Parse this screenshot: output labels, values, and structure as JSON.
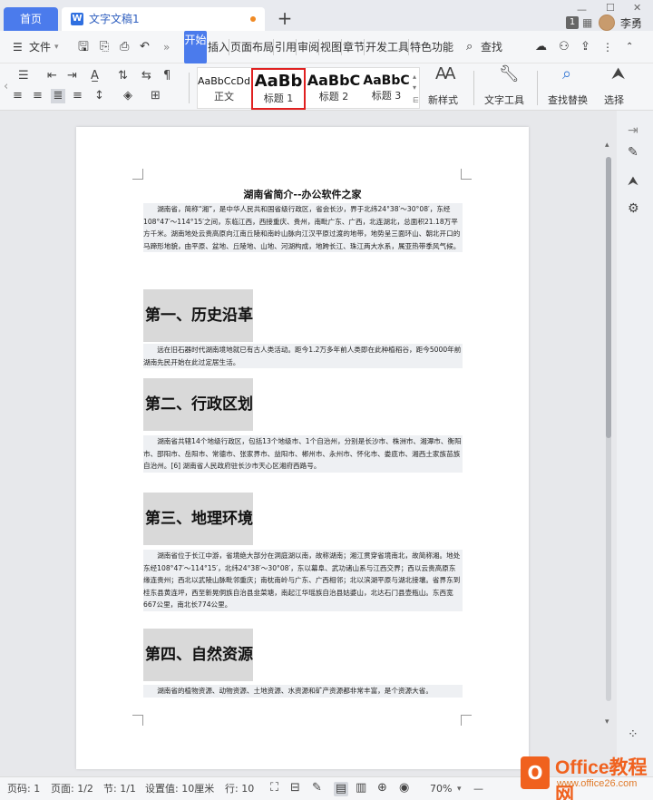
{
  "tabs": {
    "home": "首页",
    "doc_icon": "W",
    "doc_title": "文字文稿1",
    "plus": "+",
    "badge": "1",
    "user_name": "李勇"
  },
  "menu": {
    "file": "文件",
    "items": [
      "开始",
      "插入",
      "页面布局",
      "引用",
      "审阅",
      "视图",
      "章节",
      "开发工具",
      "特色功能"
    ],
    "search": "查找"
  },
  "ribbon": {
    "styles": [
      {
        "sample": "AaBbCcDd",
        "label": "正文"
      },
      {
        "sample": "AaBb",
        "label": "标题 1"
      },
      {
        "sample": "AaBbC",
        "label": "标题 2"
      },
      {
        "sample": "AaBbC",
        "label": "标题 3"
      }
    ],
    "new_style": "新样式",
    "text_tools": "文字工具",
    "find_replace": "查找替换",
    "select": "选择"
  },
  "document": {
    "title": "湖南省简介--办公软件之家",
    "intro": "湖南省，简称“湘”，是中华人民共和国省级行政区，省会长沙，界于北纬24°38′～30°08′，东经108°47′～114°15′之间，东临江西，西接重庆、贵州，南毗广东、广西，北连湖北，总面积21.18万平方千米。湖南地处云贵高原向江南丘陵和南岭山脉向江汉平原过渡的地带，地势呈三面环山、朝北开口的马蹄形地貌，由平原、盆地、丘陵地、山地、河湖构成，地跨长江、珠江两大水系，属亚热带季风气候。",
    "sections": [
      {
        "heading": "第一、历史沿革",
        "body": "远在旧石器时代湖南境地就已有古人类活动。距今1.2万多年前人类即在此种植稻谷，距今5000年前湖南先民开始在此过定居生活。"
      },
      {
        "heading": "第二、行政区划",
        "body": "湖南省共辖14个地级行政区，包括13个地级市、1个自治州，分别是长沙市、株洲市、湘潭市、衡阳市、邵阳市、岳阳市、常德市、张家界市、益阳市、郴州市、永州市、怀化市、娄底市、湘西土家族苗族自治州。[6] 湖南省人民政府驻长沙市天心区湘府西路号。"
      },
      {
        "heading": "第三、地理环境",
        "body": "湖南省位于长江中游，省境绝大部分在洞庭湖以南，故称湖南；湘江贯穿省境南北，故简称湘。地处东经108°47′～114°15′，北纬24°38′～30°08′，东以幕阜、武功诸山系与江西交界；西以云贵高原东缘连贵州；西北以武陵山脉毗邻重庆；南枕南岭与广东、广西相邻；北以滨湖平原与湖北接壤。省界东到桂东县黄连坪，西至新晃侗族自治县韭菜塘，南起江华瑶族自治县姑婆山，北达石门县壶瓶山。东西宽667公里，南北长774公里。"
      },
      {
        "heading": "第四、自然资源",
        "body": "湖南省的植物资源、动物资源、土地资源、水资源和矿产资源都非常丰富，是个资源大省。"
      }
    ]
  },
  "status": {
    "page_no": "页码: 1",
    "page": "页面: 1/2",
    "section": "节: 1/1",
    "setting": "设置值: 10厘米",
    "row": "行: 10",
    "zoom": "70%"
  },
  "watermark": {
    "logo": "O",
    "text": "Office教程网",
    "url": "www.office26.com"
  }
}
